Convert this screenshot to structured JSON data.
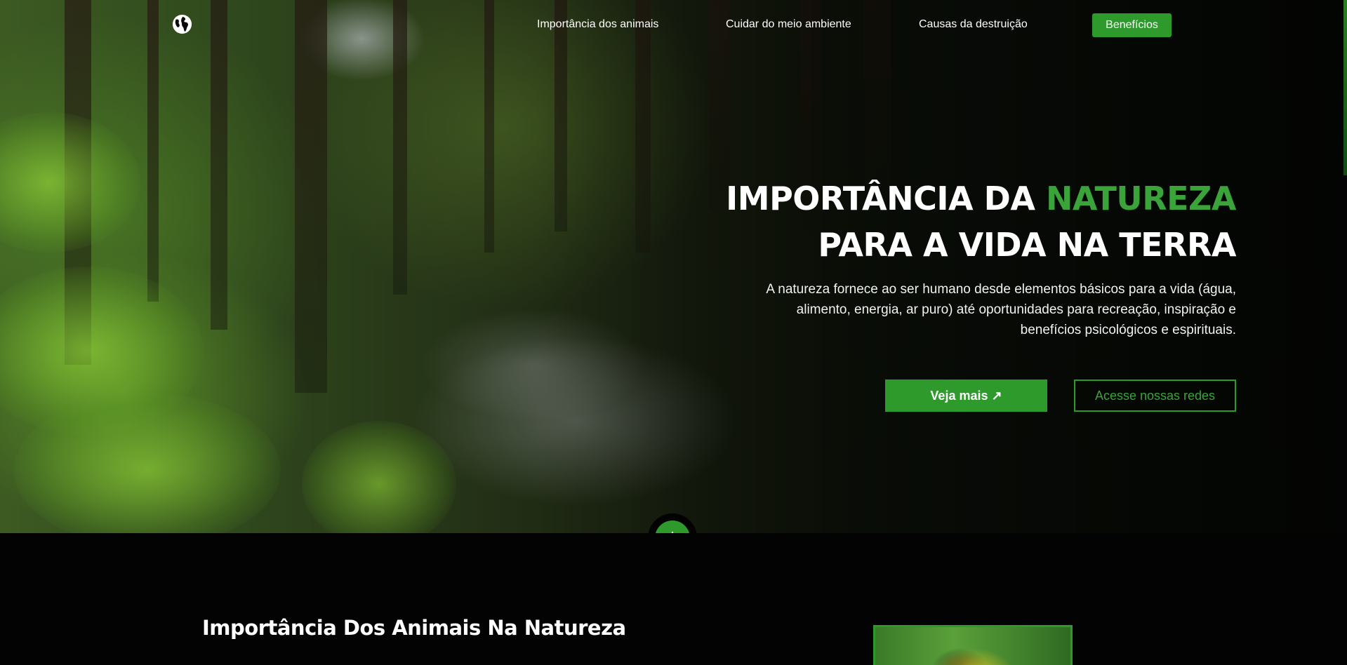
{
  "nav": {
    "logo_icon": "globe-icon",
    "links": [
      "Importância dos animais",
      "Cuidar do meio ambiente",
      "Causas da destruição"
    ],
    "cta_label": "Benefícios"
  },
  "hero": {
    "title_part1": "IMPORTÂNCIA DA ",
    "title_accent": "NATUREZA",
    "title_line2": "PARA A VIDA NA TERRA",
    "description": "A natureza fornece ao ser humano desde elementos básicos para a vida (água, alimento, energia, ar puro) até oportunidades para recreação, inspiração e benefícios psicológicos e espirituais.",
    "primary_button": "Veja mais ↗",
    "secondary_button": "Acesse nossas redes",
    "scroll_icon": "arrow-down-icon"
  },
  "section_animals": {
    "title": "Importância Dos Animais Na Natureza"
  },
  "colors": {
    "accent": "#2e9a2c",
    "accent_text": "#3aa43a",
    "background": "#030303"
  }
}
